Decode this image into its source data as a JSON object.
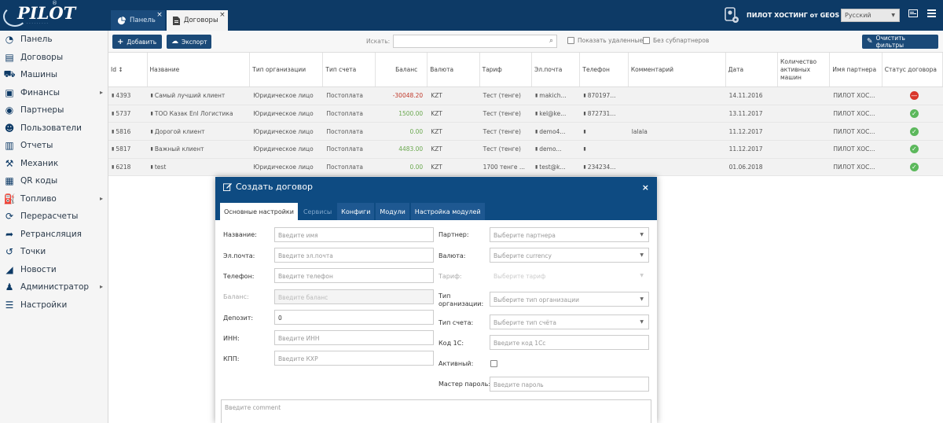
{
  "header": {
    "logo": "PILOT",
    "logo_sub": "· · · · · · · · ·",
    "logo_reg": "®",
    "tabs": [
      {
        "label": "Панель",
        "close": "×"
      },
      {
        "label": "Договоры",
        "close": "×"
      }
    ],
    "hosting_label": "ПИЛОТ ХОСТИНГ от GEOS",
    "language": "Русский"
  },
  "sidebar": {
    "items": [
      {
        "label": "Панель",
        "icon": "dashboard-icon"
      },
      {
        "label": "Договоры",
        "icon": "document-icon"
      },
      {
        "label": "Машины",
        "icon": "car-icon"
      },
      {
        "label": "Финансы",
        "icon": "finance-icon"
      },
      {
        "label": "Партнеры",
        "icon": "partner-icon"
      },
      {
        "label": "Пользователи",
        "icon": "users-icon"
      },
      {
        "label": "Отчеты",
        "icon": "report-icon"
      },
      {
        "label": "Механик",
        "icon": "wrench-icon"
      },
      {
        "label": "QR коды",
        "icon": "qr-icon"
      },
      {
        "label": "Топливо",
        "icon": "fuel-icon"
      },
      {
        "label": "Перерасчеты",
        "icon": "refresh-icon"
      },
      {
        "label": "Ретрансляция",
        "icon": "share-icon"
      },
      {
        "label": "Точки",
        "icon": "history-icon"
      },
      {
        "label": "Новости",
        "icon": "rss-icon"
      },
      {
        "label": "Администратор",
        "icon": "admin-icon"
      },
      {
        "label": "Настройки",
        "icon": "settings-icon"
      }
    ]
  },
  "toolbar": {
    "add_label": "Добавить",
    "export_label": "Экспорт",
    "search_label": "Искать:",
    "show_deleted_label": "Показать удаленные",
    "no_subpartners_label": "Без субпартнеров",
    "clear_filters_label": "Очистить фильтры"
  },
  "table": {
    "columns": [
      "Id ↕",
      "Название",
      "Тип организации",
      "Тип счета",
      "Баланс",
      "Валюта",
      "Тариф",
      "Эл.почта",
      "Телефон",
      "Комментарий",
      "Дата",
      "Количество активных машин",
      "Имя партнера",
      "Статус договора"
    ],
    "rows": [
      {
        "id": "4393",
        "name": "Самый лучший клиент",
        "org": "Юридическое лицо",
        "acct": "Постоплата",
        "balance": "-30048.20",
        "currency": "KZT",
        "tariff": "Тест (тенге)",
        "email": "makich...",
        "phone": "870197...",
        "comment": "",
        "date": "14.11.2016",
        "cars": "",
        "partner": "ПИЛОТ ХОС...",
        "status": "blocked"
      },
      {
        "id": "5737",
        "name": "ТОО Казак Enl Логистика",
        "org": "Юридическое лицо",
        "acct": "Постоплата",
        "balance": "1500.00",
        "currency": "KZT",
        "tariff": "Тест (тенге)",
        "email": "kel@ke...",
        "phone": "872731...",
        "comment": "",
        "date": "13.11.2017",
        "cars": "",
        "partner": "ПИЛОТ ХОС...",
        "status": "active"
      },
      {
        "id": "5816",
        "name": "Дорогой клиент",
        "org": "Юридическое лицо",
        "acct": "Постоплата",
        "balance": "0.00",
        "currency": "KZT",
        "tariff": "Тест (тенге)",
        "email": "demo4...",
        "phone": "",
        "comment": "lalala",
        "date": "11.12.2017",
        "cars": "",
        "partner": "ПИЛОТ ХОС...",
        "status": "active"
      },
      {
        "id": "5817",
        "name": "Важный клиент",
        "org": "Юридическое лицо",
        "acct": "Постоплата",
        "balance": "4483.00",
        "currency": "KZT",
        "tariff": "Тест (тенге)",
        "email": "demo...",
        "phone": "",
        "comment": "",
        "date": "11.12.2017",
        "cars": "",
        "partner": "ПИЛОТ ХОС...",
        "status": "active"
      },
      {
        "id": "6218",
        "name": "test",
        "org": "Юридическое лицо",
        "acct": "Постоплата",
        "balance": "0.00",
        "currency": "KZT",
        "tariff": "1700 тенге ...",
        "email": "test@k...",
        "phone": "234234...",
        "comment": "",
        "date": "01.06.2018",
        "cars": "",
        "partner": "ПИЛОТ ХОС...",
        "status": "active"
      }
    ]
  },
  "modal": {
    "title": "Создать договор",
    "close": "×",
    "tabs": [
      {
        "label": "Основные настройки",
        "state": "active"
      },
      {
        "label": "Сервисы",
        "state": "disabled"
      },
      {
        "label": "Конфиги",
        "state": "normal"
      },
      {
        "label": "Модули",
        "state": "normal"
      },
      {
        "label": "Настройка модулей",
        "state": "normal"
      }
    ],
    "fields": {
      "name_label": "Название:",
      "name_placeholder": "Введите имя",
      "email_label": "Эл.почта:",
      "email_placeholder": "Введите эл.почта",
      "phone_label": "Телефон:",
      "phone_placeholder": "Введите телефон",
      "balance_label": "Баланс:",
      "balance_placeholder": "Введите баланс",
      "deposit_label": "Депозит:",
      "deposit_value": "0",
      "inn_label": "ИНН:",
      "inn_placeholder": "Введите ИНН",
      "kpp_label": "КПП:",
      "kpp_placeholder": "Введите КХР",
      "partner_label": "Партнер:",
      "partner_placeholder": "Выберите партнера",
      "currency_label": "Валюта:",
      "currency_placeholder": "Выберите currency",
      "tariff_label": "Тариф:",
      "tariff_placeholder": "Выберите тариф",
      "orgtype_label": "Тип организации:",
      "orgtype_placeholder": "Выберите тип организации",
      "accttype_label": "Тип счета:",
      "accttype_placeholder": "Выберите тип счёта",
      "code1c_label": "Код 1С:",
      "code1c_placeholder": "Введите код 1Сс",
      "active_label": "Активный:",
      "masterpw_label": "Мастер пароль:",
      "masterpw_placeholder": "Введите пароль",
      "comment_placeholder": "Введите comment"
    }
  },
  "colors": {
    "primary": "#0d3a66",
    "button": "#1b4a78",
    "negative": "#c0392b",
    "positive": "#6aa84f"
  }
}
